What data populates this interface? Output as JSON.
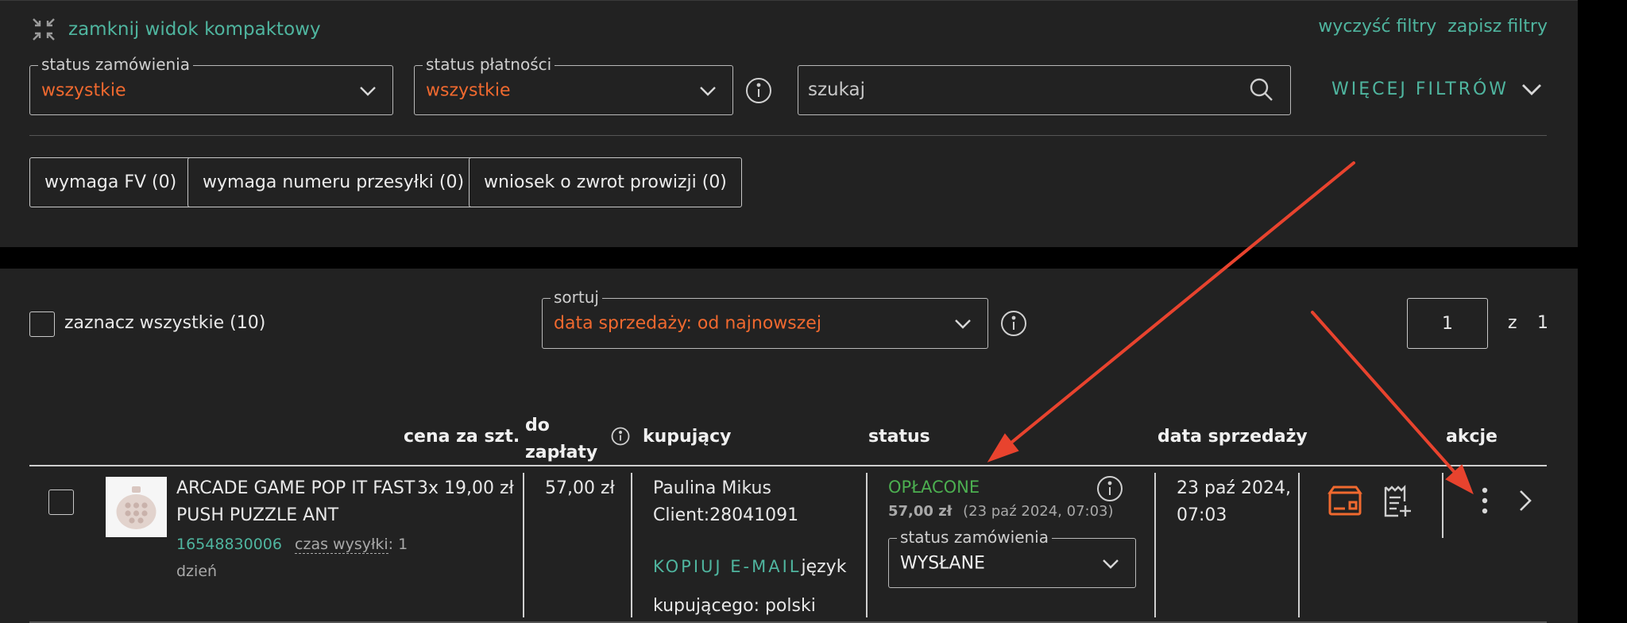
{
  "top": {
    "compact_view_label": "zamknij widok kompaktowy",
    "clear_filters": "wyczyść filtry",
    "save_filters": "zapisz filtry",
    "order_status_filter": {
      "legend": "status zamówienia",
      "value": "wszystkie"
    },
    "payment_status_filter": {
      "legend": "status płatności",
      "value": "wszystkie"
    },
    "search": {
      "placeholder": "szukaj"
    },
    "more_filters": "WIĘCEJ FILTRÓW",
    "chips": [
      "wymaga FV (0)",
      "wymaga numeru przesyłki (0)",
      "wniosek o zwrot prowizji (0)"
    ]
  },
  "list": {
    "select_all": "zaznacz wszystkie (10)",
    "sort": {
      "legend": "sortuj",
      "value": "data sprzedaży: od najnowszej"
    },
    "page": {
      "current": "1",
      "of": "z",
      "total": "1"
    },
    "columns": {
      "price": "cena za szt.",
      "to_pay_line1": "do",
      "to_pay_line2": "zapłaty",
      "buyer": "kupujący",
      "status": "status",
      "sale_date": "data sprzedaży",
      "actions": "akcje"
    },
    "row": {
      "product_line1": "ARCADE GAME POP IT FAST",
      "product_line2": "PUSH PUZZLE ANT",
      "offer_id": "16548830006",
      "shipping_label": "czas wysyłki",
      "shipping_value_a": ": 1",
      "shipping_value_b": "dzień",
      "unit_price": "3x 19,00 zł",
      "to_pay": "57,00 zł",
      "buyer_name": "Paulina Mikus",
      "client_id": "Client:28041091",
      "copy_email": "KOPIUJ E-MAIL",
      "lang_a": "język",
      "lang_b": "kupującego: polski",
      "payment_status": "OPŁACONE",
      "paid_amount": "57,00 zł",
      "paid_date": "(23 paź 2024, 07:03)",
      "order_status": {
        "legend": "status zamówienia",
        "value": "WYSŁANE"
      },
      "sale_date_line1": "23 paź 2024,",
      "sale_date_line2": "07:03"
    }
  },
  "colors": {
    "accent_teal": "#4fb59f",
    "accent_orange": "#f0692f",
    "paid_green": "#4caf50",
    "annotation_red": "#e8432e"
  }
}
